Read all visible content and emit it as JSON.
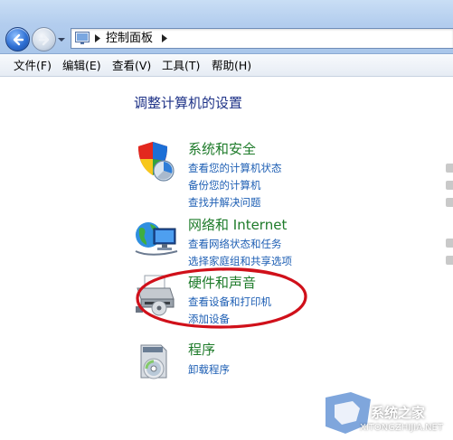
{
  "address_bar": {
    "breadcrumb": "控制面板"
  },
  "menu": {
    "items": [
      "文件(F)",
      "编辑(E)",
      "查看(V)",
      "工具(T)",
      "帮助(H)"
    ]
  },
  "main": {
    "title": "调整计算机的设置",
    "categories": [
      {
        "title": "系统和安全",
        "icon": "shield-icon",
        "links": [
          "查看您的计算机状态",
          "备份您的计算机",
          "查找并解决问题"
        ]
      },
      {
        "title": "网络和 Internet",
        "icon": "network-icon",
        "links": [
          "查看网络状态和任务",
          "选择家庭组和共享选项"
        ]
      },
      {
        "title": "硬件和声音",
        "icon": "printer-icon",
        "links": [
          "查看设备和打印机",
          "添加设备"
        ]
      },
      {
        "title": "程序",
        "icon": "programs-icon",
        "links": [
          "卸载程序"
        ]
      }
    ]
  },
  "watermark": {
    "text": "系统之家",
    "subtext": "XITONGZHIJIA.NET"
  },
  "colors": {
    "category_title": "#1e7b2a",
    "link": "#1e5fb4",
    "page_title": "#1e3287",
    "annotation": "#d0101a"
  }
}
